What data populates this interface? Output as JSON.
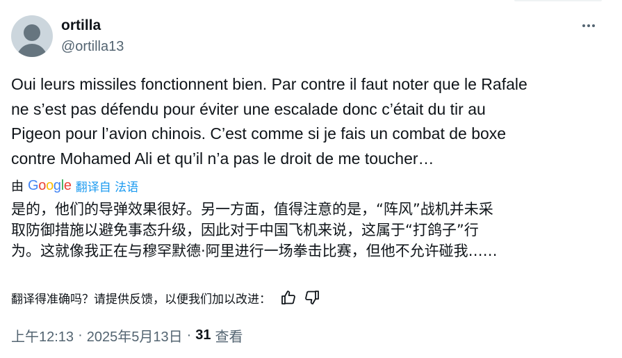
{
  "author": {
    "display_name": "ortilla",
    "handle": "@ortilla13"
  },
  "more_icon": "more-horizontal-icon",
  "tweet_text": "Oui leurs missiles fonctionnent bien. Par contre il faut noter que le Rafale\nne s’est pas défendu pour éviter une escalade donc c’était du tir au\nPigeon pour l’avion chinois. C’est comme si je fais un combat de boxe\ncontre Mohamed Ali et qu’il n’a pas le droit de me toucher…",
  "translation": {
    "prefix": "由",
    "provider": "Google",
    "link_label": "翻译自 法语",
    "text": "是的，他们的导弹效果很好。另一方面，值得注意的是，“阵风”战机并未采\n取防御措施以避免事态升级，因此对于中国飞机来说，这属于“打鸽子”行\n为。这就像我正在与穆罕默德·阿里进行一场拳击比赛，但他不允许碰我……",
    "feedback_question": "翻译得准确吗？请提供反馈，以便我们加以改进："
  },
  "meta": {
    "time": "上午12:13",
    "date": "2025年5月13日",
    "separator": "·",
    "views_count": "31",
    "views_label": "查看"
  },
  "colors": {
    "text": "#0f1419",
    "secondary": "#536471",
    "link": "#1d9bf0"
  }
}
